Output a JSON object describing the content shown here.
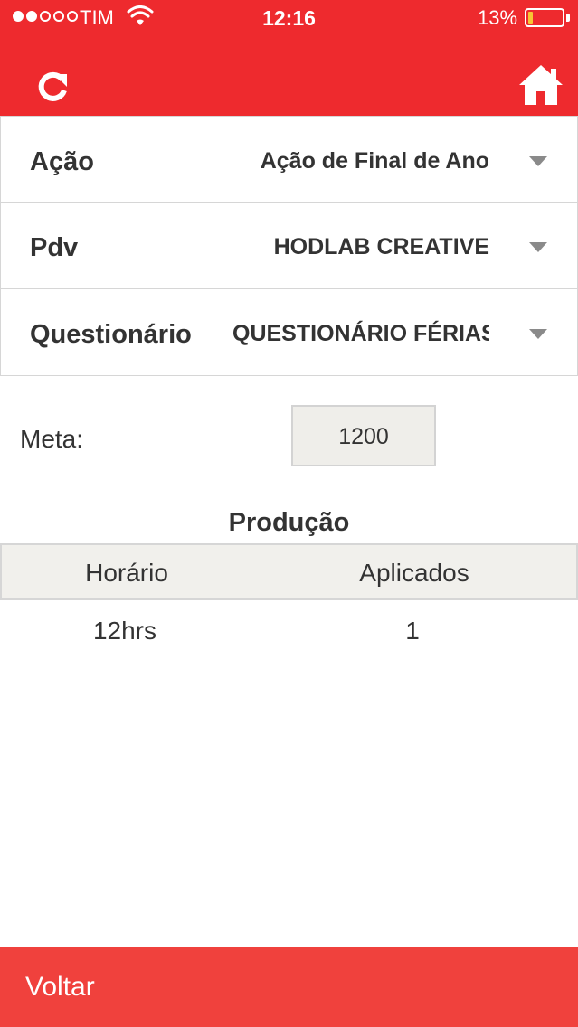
{
  "status_bar": {
    "carrier": "TIM",
    "time": "12:16",
    "battery_percent": "13%",
    "battery_level": 0.13,
    "signal_bars": 2,
    "signal_total": 5
  },
  "header": {
    "refresh_icon": "refresh-icon",
    "home_icon": "home-icon"
  },
  "form": {
    "acao": {
      "label": "Ação",
      "value": "Ação de Final de Ano"
    },
    "pdv": {
      "label": "Pdv",
      "value": "HODLAB CREATIVE"
    },
    "questionario": {
      "label": "Questionário",
      "value": "QUESTIONÁRIO FÉRIAS"
    }
  },
  "meta": {
    "label": "Meta:",
    "value": "1200"
  },
  "producao": {
    "title": "Produção",
    "columns": [
      "Horário",
      "Aplicados"
    ],
    "rows": [
      [
        "12hrs",
        "1"
      ]
    ]
  },
  "footer": {
    "back_label": "Voltar"
  },
  "colors": {
    "brand_red": "#ee2a2e",
    "footer_red": "#f0413d",
    "battery_yellow": "#f7c534"
  }
}
